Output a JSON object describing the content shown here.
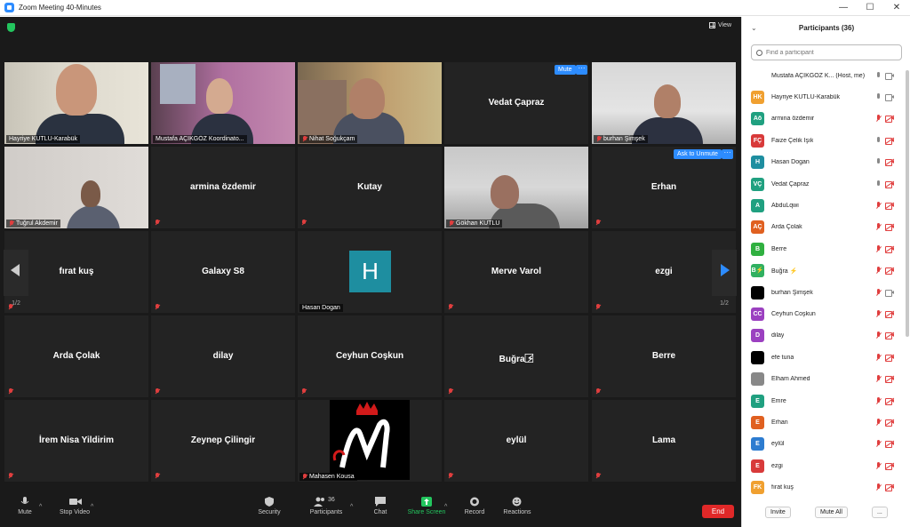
{
  "window": {
    "title": "Zoom Meeting 40-Minutes",
    "controls": [
      "—",
      "☐",
      "✕"
    ]
  },
  "header": {
    "view_label": "View"
  },
  "tiles": [
    {
      "label": "Hayriye KUTLU-Karabük",
      "type": "video"
    },
    {
      "label": "Mustafa AÇIKGÖZ Koordinato...",
      "type": "video"
    },
    {
      "label": "Nihat Soğukçam",
      "type": "video"
    },
    {
      "label": "Vedat Çapraz",
      "type": "name",
      "mute_label": "Mute"
    },
    {
      "label": "burhan Şimşek",
      "type": "video"
    },
    {
      "label": "Tuğrul Akdemir",
      "type": "video"
    },
    {
      "label": "armina özdemir",
      "type": "name"
    },
    {
      "label": "Kutay",
      "type": "name"
    },
    {
      "label": "Gökhan KUTLU",
      "type": "video"
    },
    {
      "label": "Erhan",
      "type": "name",
      "unmute_label": "Ask to Unmute"
    },
    {
      "label": "fırat kuş",
      "type": "name"
    },
    {
      "label": "Galaxy S8",
      "type": "name"
    },
    {
      "label": "Hasan Dogan",
      "type": "avatar",
      "initial": "H"
    },
    {
      "label": "Merve Varol",
      "type": "name"
    },
    {
      "label": "ezgi",
      "type": "name"
    },
    {
      "label": "Arda Çolak",
      "type": "name"
    },
    {
      "label": "dilay",
      "type": "name"
    },
    {
      "label": "Ceyhun Coşkun",
      "type": "name"
    },
    {
      "label": "Buğra ⚡︎⃞",
      "type": "name"
    },
    {
      "label": "Berre",
      "type": "name"
    },
    {
      "label": "İrem Nisa Yildirim",
      "type": "name"
    },
    {
      "label": "Zeynep Çilingir",
      "type": "name"
    },
    {
      "label": "Mahasen Kousa",
      "type": "logo"
    },
    {
      "label": "eylül",
      "type": "name"
    },
    {
      "label": "Lama",
      "type": "name"
    }
  ],
  "pagination": {
    "left": "1/2",
    "right": "1/2"
  },
  "toolbar": {
    "mute": "Mute",
    "stop_video": "Stop Video",
    "security": "Security",
    "participants": "Participants",
    "participants_count": "36",
    "chat": "Chat",
    "share_screen": "Share Screen",
    "record": "Record",
    "reactions": "Reactions",
    "end": "End"
  },
  "panel": {
    "title": "Participants (36)",
    "search_placeholder": "Find a participant",
    "invite": "Invite",
    "mute_all": "Mute All",
    "more": "...",
    "participants": [
      {
        "initials": "",
        "name": "Mustafa AÇIKGÖZ K...  (Host, me)",
        "color": "#ffffff",
        "mic": "on",
        "cam": "on"
      },
      {
        "initials": "HK",
        "name": "Hayriye KUTLU-Karabük",
        "color": "#f0a030",
        "mic": "on",
        "cam": "on"
      },
      {
        "initials": "Aö",
        "name": "armina özdemir",
        "color": "#20a080",
        "mic": "muted",
        "cam": "off"
      },
      {
        "initials": "FÇ",
        "name": "Faize Çelik Işık",
        "color": "#d83a3a",
        "mic": "on",
        "cam": "off"
      },
      {
        "initials": "H",
        "name": "Hasan Dogan",
        "color": "#1e8ea0",
        "mic": "on",
        "cam": "off"
      },
      {
        "initials": "VÇ",
        "name": "Vedat Çapraz",
        "color": "#20a080",
        "mic": "on",
        "cam": "off"
      },
      {
        "initials": "A",
        "name": "AbduLqwi",
        "color": "#20a080",
        "mic": "muted",
        "cam": "off"
      },
      {
        "initials": "AÇ",
        "name": "Arda Çolak",
        "color": "#e06020",
        "mic": "muted",
        "cam": "off"
      },
      {
        "initials": "B",
        "name": "Berre",
        "color": "#30b040",
        "mic": "muted",
        "cam": "off"
      },
      {
        "initials": "B⚡",
        "name": "Buğra ⚡",
        "color": "#30b060",
        "mic": "muted",
        "cam": "off"
      },
      {
        "initials": "",
        "name": "burhan Şimşek",
        "color": "#000000",
        "mic": "muted",
        "cam": "on"
      },
      {
        "initials": "CC",
        "name": "Ceyhun Coşkun",
        "color": "#9b40c0",
        "mic": "muted",
        "cam": "off"
      },
      {
        "initials": "D",
        "name": "dilay",
        "color": "#9b40c0",
        "mic": "muted",
        "cam": "off"
      },
      {
        "initials": "",
        "name": "efe tuna",
        "color": "#000000",
        "mic": "muted",
        "cam": "off"
      },
      {
        "initials": "",
        "name": "Elham Ahmed",
        "color": "#888888",
        "mic": "muted",
        "cam": "off"
      },
      {
        "initials": "E",
        "name": "Emre",
        "color": "#20a080",
        "mic": "muted",
        "cam": "off"
      },
      {
        "initials": "E",
        "name": "Erhan",
        "color": "#e06020",
        "mic": "muted",
        "cam": "off"
      },
      {
        "initials": "E",
        "name": "eylül",
        "color": "#2d7cd0",
        "mic": "muted",
        "cam": "off"
      },
      {
        "initials": "E",
        "name": "ezgi",
        "color": "#d83a3a",
        "mic": "muted",
        "cam": "off"
      },
      {
        "initials": "FK",
        "name": "fırat kuş",
        "color": "#f0a030",
        "mic": "muted",
        "cam": "off"
      }
    ]
  }
}
